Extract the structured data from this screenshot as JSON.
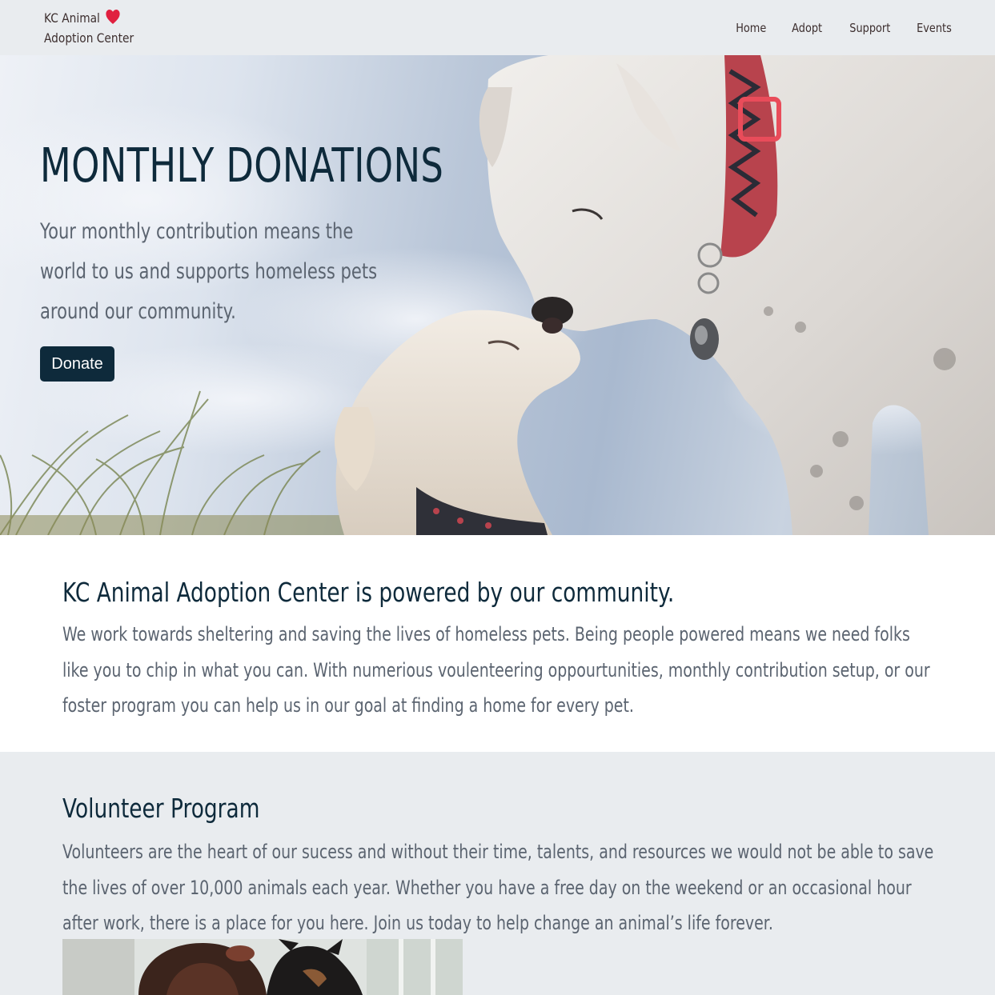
{
  "header": {
    "logo_line1": "KC Animal",
    "logo_line2": "Adoption Center",
    "heart_color": "#e0203f",
    "nav": [
      "Home",
      "Adopt",
      "Support",
      "Events"
    ]
  },
  "hero": {
    "title": "MONTHLY DONATIONS",
    "subtitle": "Your monthly contribution means the world to us and supports homeless pets around our community.",
    "donate_label": "Donate",
    "image": "dogs-nose-to-nose-photo"
  },
  "community": {
    "heading": "KC Animal Adoption Center is powered by our community.",
    "body": "We work towards sheltering and saving the lives of homeless pets. Being people powered means we need folks like you to chip in what you can. With numerious voulenteering oppourtunities, monthly contribution setup, or our foster program you can help us in our goal at finding a home for every pet."
  },
  "volunteer": {
    "heading": "Volunteer Program",
    "body": "Volunteers are the heart of our sucess and without their time, talents, and resources we would not be able to save the lives of over 10,000 animals each year. Whether you have a free day on the weekend or an occasional hour after work, there is a place for you here. Join us today to help change an animal’s life forever.",
    "image": "volunteer-with-dog-photo"
  },
  "colors": {
    "header_bg": "#e9ecef",
    "primary": "#0e2a3b",
    "body_text": "#5b6470"
  }
}
